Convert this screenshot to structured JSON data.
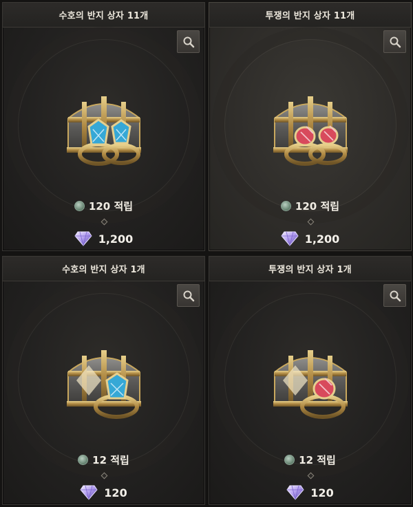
{
  "products": [
    {
      "title": "수호의 반지 상자 11개",
      "mileage": "120 적립",
      "price": "1,200",
      "ring_color": "#36a8d6",
      "count_rings": 2
    },
    {
      "title": "투쟁의 반지 상자 11개",
      "mileage": "120 적립",
      "price": "1,200",
      "ring_color": "#d84a5c",
      "count_rings": 2
    },
    {
      "title": "수호의 반지 상자 1개",
      "mileage": "12 적립",
      "price": "120",
      "ring_color": "#36a8d6",
      "count_rings": 1
    },
    {
      "title": "투쟁의 반지 상자 1개",
      "mileage": "12 적립",
      "price": "120",
      "ring_color": "#d84a5c",
      "count_rings": 1
    }
  ],
  "icons": {
    "zoom": "magnifier-icon",
    "mileage": "mileage-coin-icon",
    "currency": "diamond-gem-icon"
  },
  "colors": {
    "guardian_gem": "#36a8d6",
    "struggle_gem": "#d84a5c",
    "currency_gem": "#b6a2f0"
  }
}
